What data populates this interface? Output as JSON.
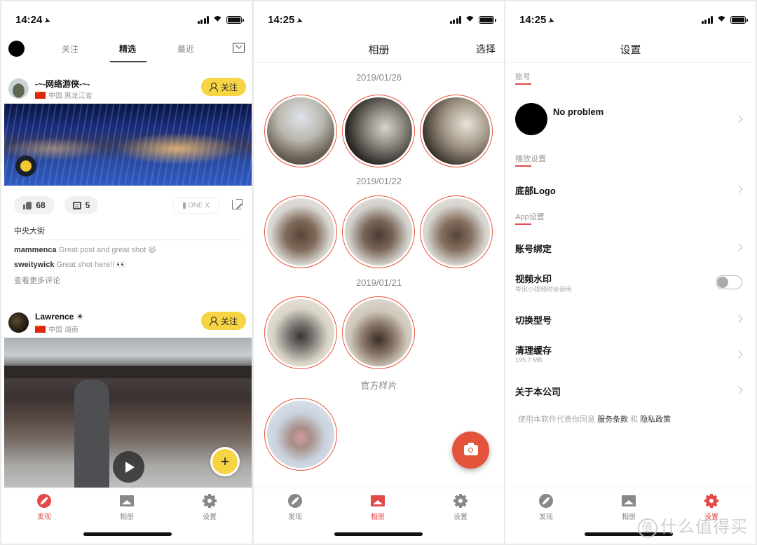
{
  "screens": {
    "discover": {
      "status": {
        "time": "14:24"
      },
      "tabs": [
        {
          "label": "关注"
        },
        {
          "label": "精选",
          "active": true
        },
        {
          "label": "最近"
        }
      ],
      "posts": [
        {
          "username": "-~-网络游侠-~-",
          "location": "中国 黑龙江省",
          "follow_label": "关注",
          "likes": "68",
          "comments_count": "5",
          "device": "ONE X",
          "caption": "中央大街",
          "comments": [
            {
              "user": "mammenca",
              "text": "Great post and great shot 😆"
            },
            {
              "user": "sweitywick",
              "text": "Great shot here!! 👀"
            }
          ],
          "more_comments": "查看更多评论"
        },
        {
          "username": "Lawrence ☀",
          "location": "中国 湖南",
          "follow_label": "关注"
        }
      ],
      "fab_label": "+"
    },
    "album": {
      "status": {
        "time": "14:25"
      },
      "title": "相册",
      "select_label": "选择",
      "groups": [
        {
          "date": "2019/01/26",
          "count": 3
        },
        {
          "date": "2019/01/22",
          "count": 3
        },
        {
          "date": "2019/01/21",
          "count": 2
        },
        {
          "date": "官方样片",
          "count": 1
        }
      ]
    },
    "settings": {
      "status": {
        "time": "14:25"
      },
      "title": "设置",
      "sections": {
        "account": "账号",
        "playback": "播放设置",
        "app": "App设置"
      },
      "profile_name": "No problem",
      "rows": {
        "bottom_logo": "底部Logo",
        "account_binding": "账号绑定",
        "video_watermark": "视频水印",
        "video_watermark_sub": "导出小视频时会使用",
        "switch_model": "切换型号",
        "clear_cache": "清理缓存",
        "cache_size": "195.7 MB",
        "about": "关于本公司"
      },
      "watermark_enabled": false,
      "terms": {
        "prefix": "使用本软件代表你同意",
        "service": "服务条款",
        "and": "和",
        "privacy": "隐私政策"
      }
    }
  },
  "tabbar": [
    {
      "label": "发现",
      "icon": "compass-icon"
    },
    {
      "label": "相册",
      "icon": "album-icon"
    },
    {
      "label": "设置",
      "icon": "gear-icon"
    }
  ],
  "colors": {
    "accent_red": "#e24a4a",
    "follow_yellow": "#f6d443",
    "camera_orange": "#e2533a"
  },
  "site_watermark": {
    "glyph": "值",
    "text": "什么值得买"
  }
}
